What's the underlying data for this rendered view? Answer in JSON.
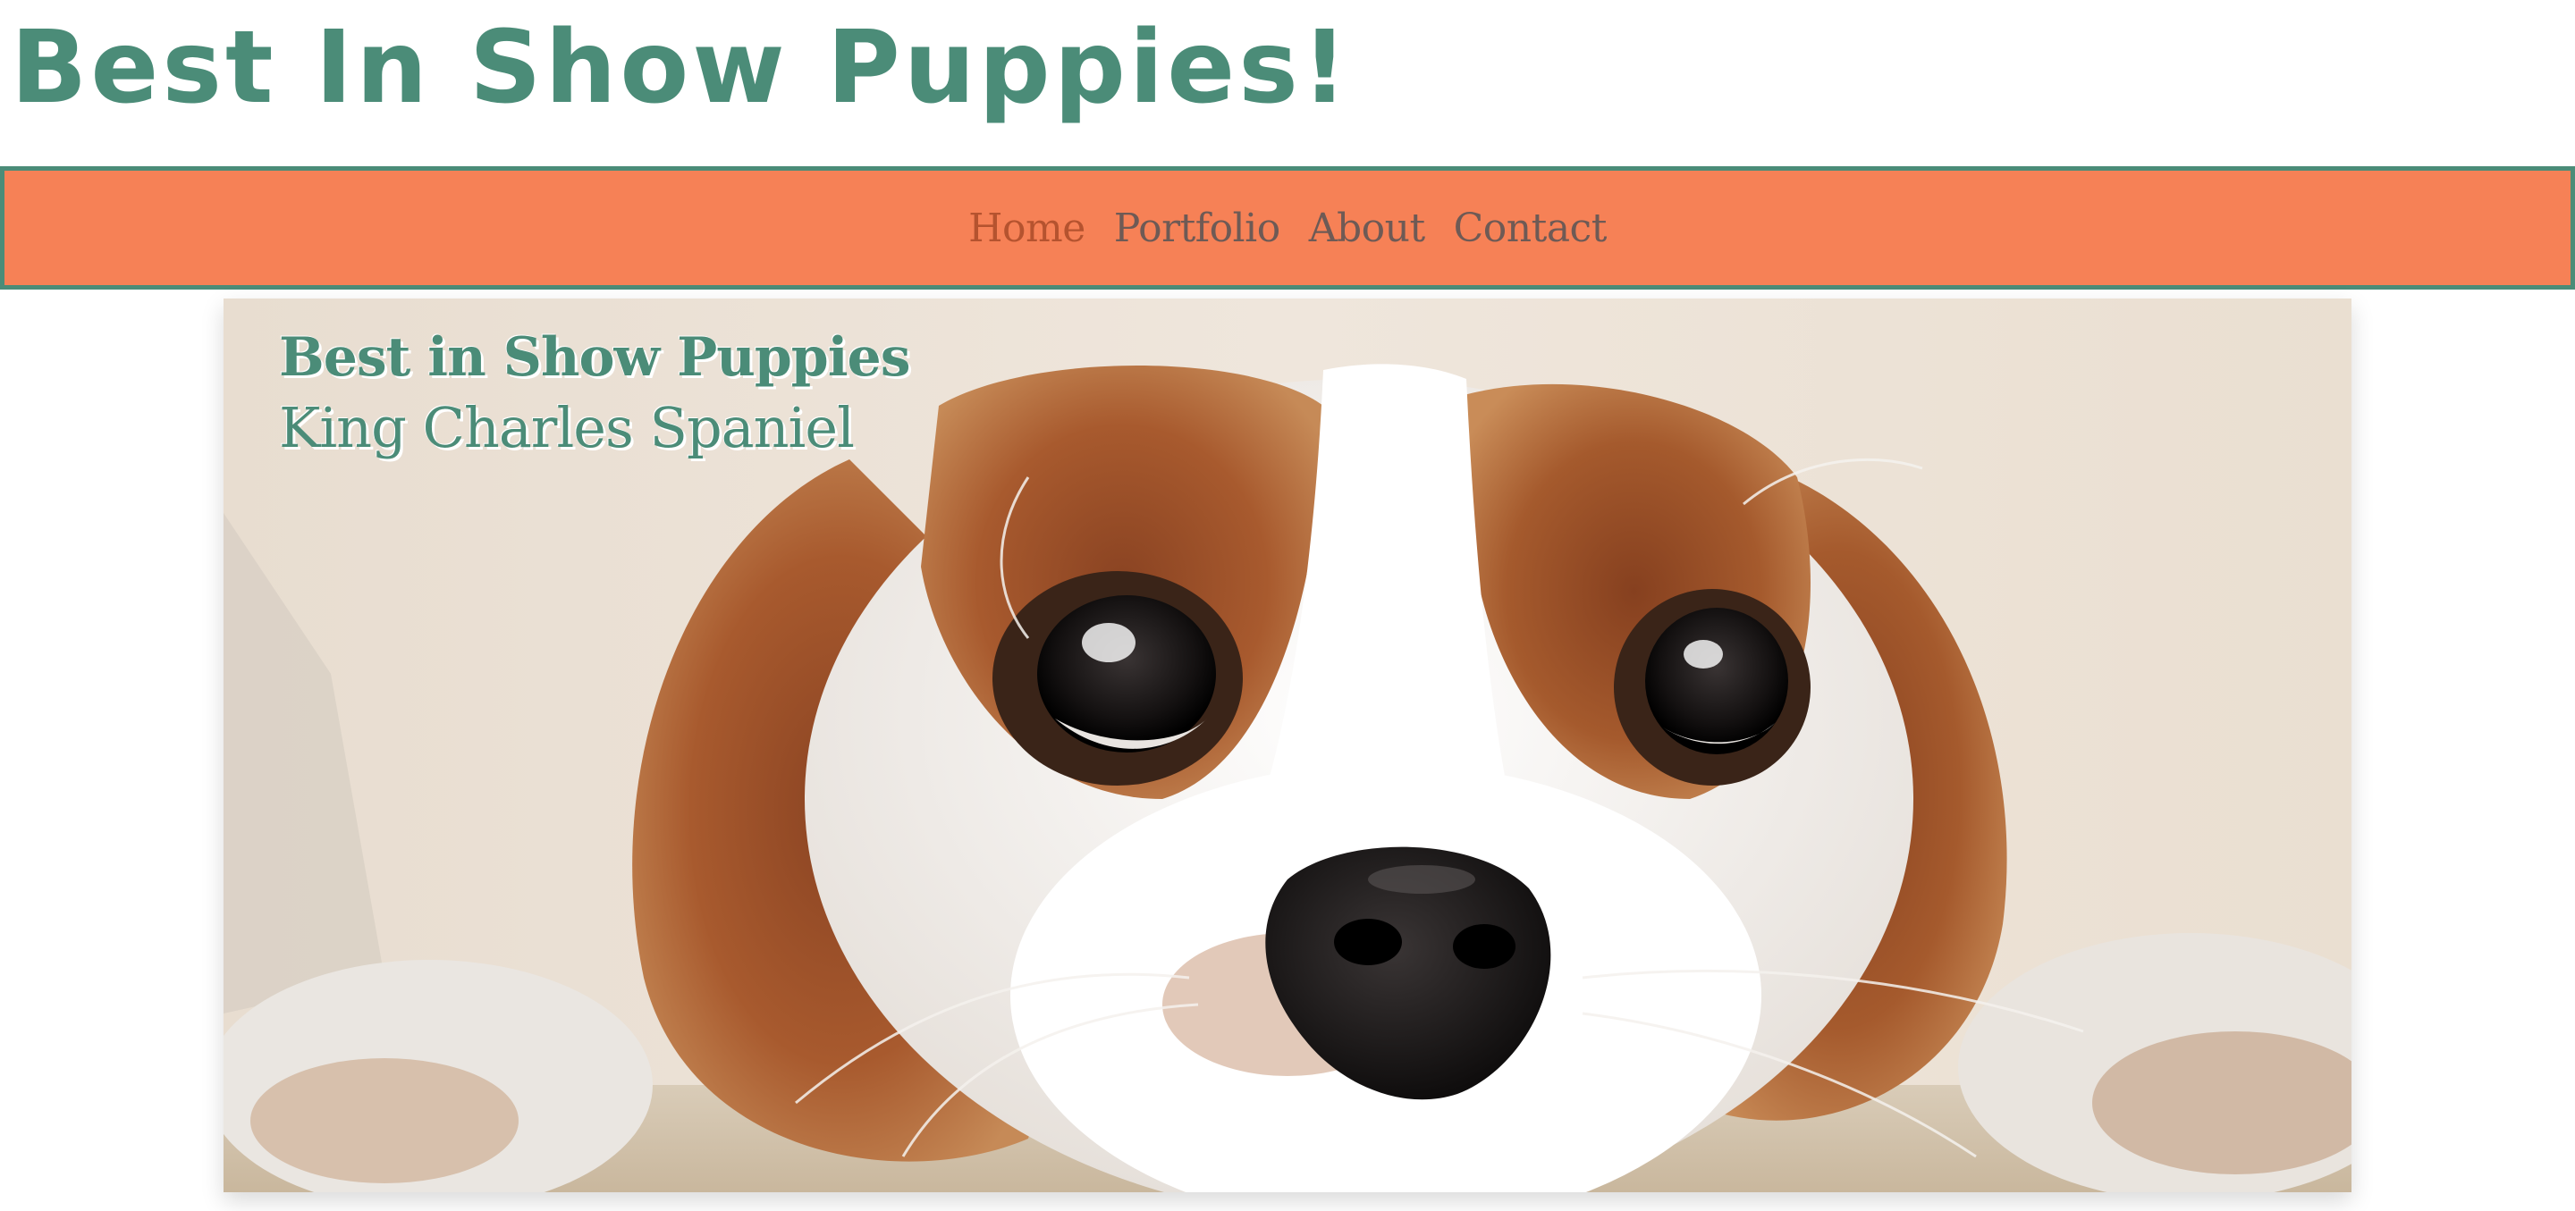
{
  "site": {
    "title": "Best In Show Puppies!"
  },
  "nav": {
    "items": [
      {
        "label": "Home",
        "active": true
      },
      {
        "label": "Portfolio",
        "active": false
      },
      {
        "label": "About",
        "active": false
      },
      {
        "label": "Contact",
        "active": false
      }
    ]
  },
  "hero": {
    "title": "Best in Show Puppies",
    "subtitle": "King Charles Spaniel",
    "image_subject": "king-charles-spaniel-puppy"
  },
  "colors": {
    "brand_green": "#4b8c78",
    "nav_orange": "#f68156",
    "nav_active": "#b5532f",
    "nav_text": "#6e5a55",
    "background": "#ffffff"
  }
}
